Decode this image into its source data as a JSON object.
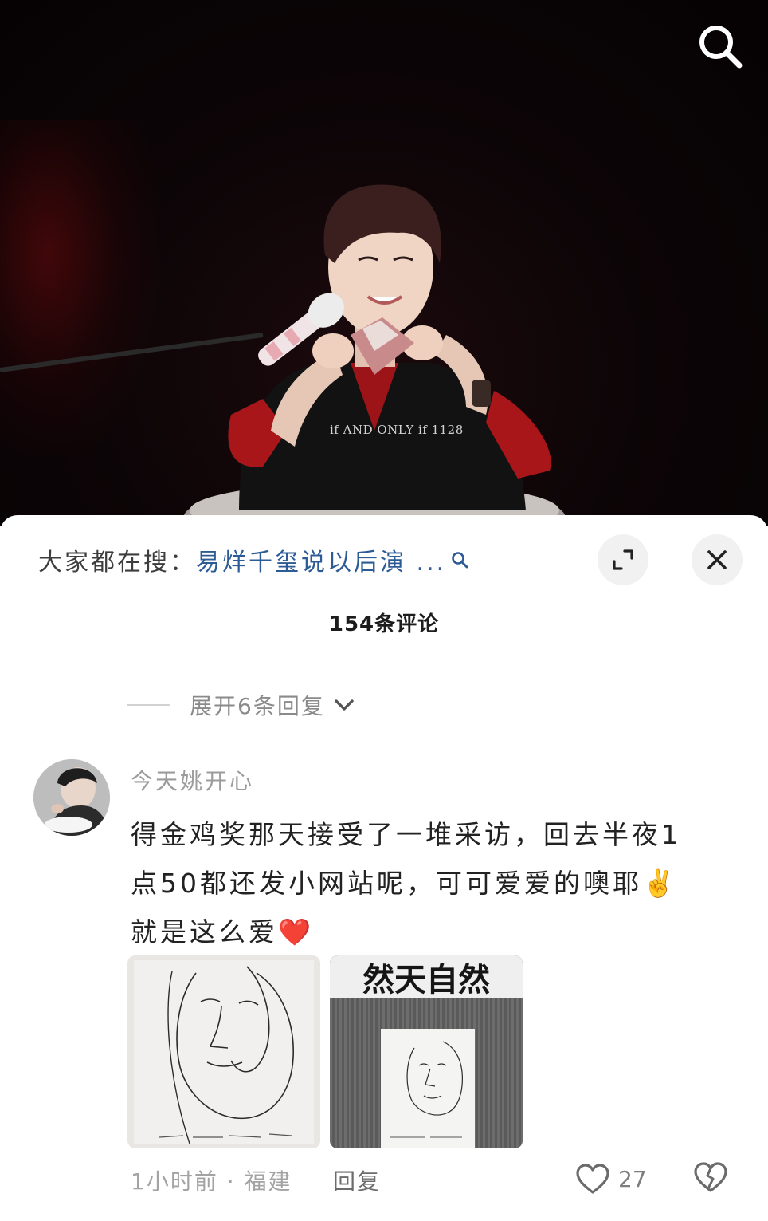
{
  "video": {
    "watermark": "if AND ONLY if 1128"
  },
  "icons": {
    "search": "search-icon",
    "expand": "expand-icon",
    "close": "close-icon",
    "chevron": "chevron-down-icon",
    "like": "heart-icon",
    "dislike": "broken-heart-icon"
  },
  "sheet": {
    "hot_search_prefix": "大家都在搜：",
    "hot_search_term": "易烊千玺说以后演 ...",
    "comment_count": "154条评论",
    "expand_replies": "展开6条回复"
  },
  "comment": {
    "username": "今天姚开心",
    "text_lines": [
      "得金鸡奖那天接受了一堆采访，回去半夜1",
      "点50都还发小网站呢，可可爱爱的噢耶✌️",
      "就是这么爱❤️"
    ],
    "time_location": "1小时前 · 福建",
    "reply_label": "回复",
    "like_count": "27",
    "thumbnail_2_banner": "然天自然"
  },
  "colors": {
    "link_blue": "#2d5b96",
    "heart_red": "#e0202a"
  }
}
